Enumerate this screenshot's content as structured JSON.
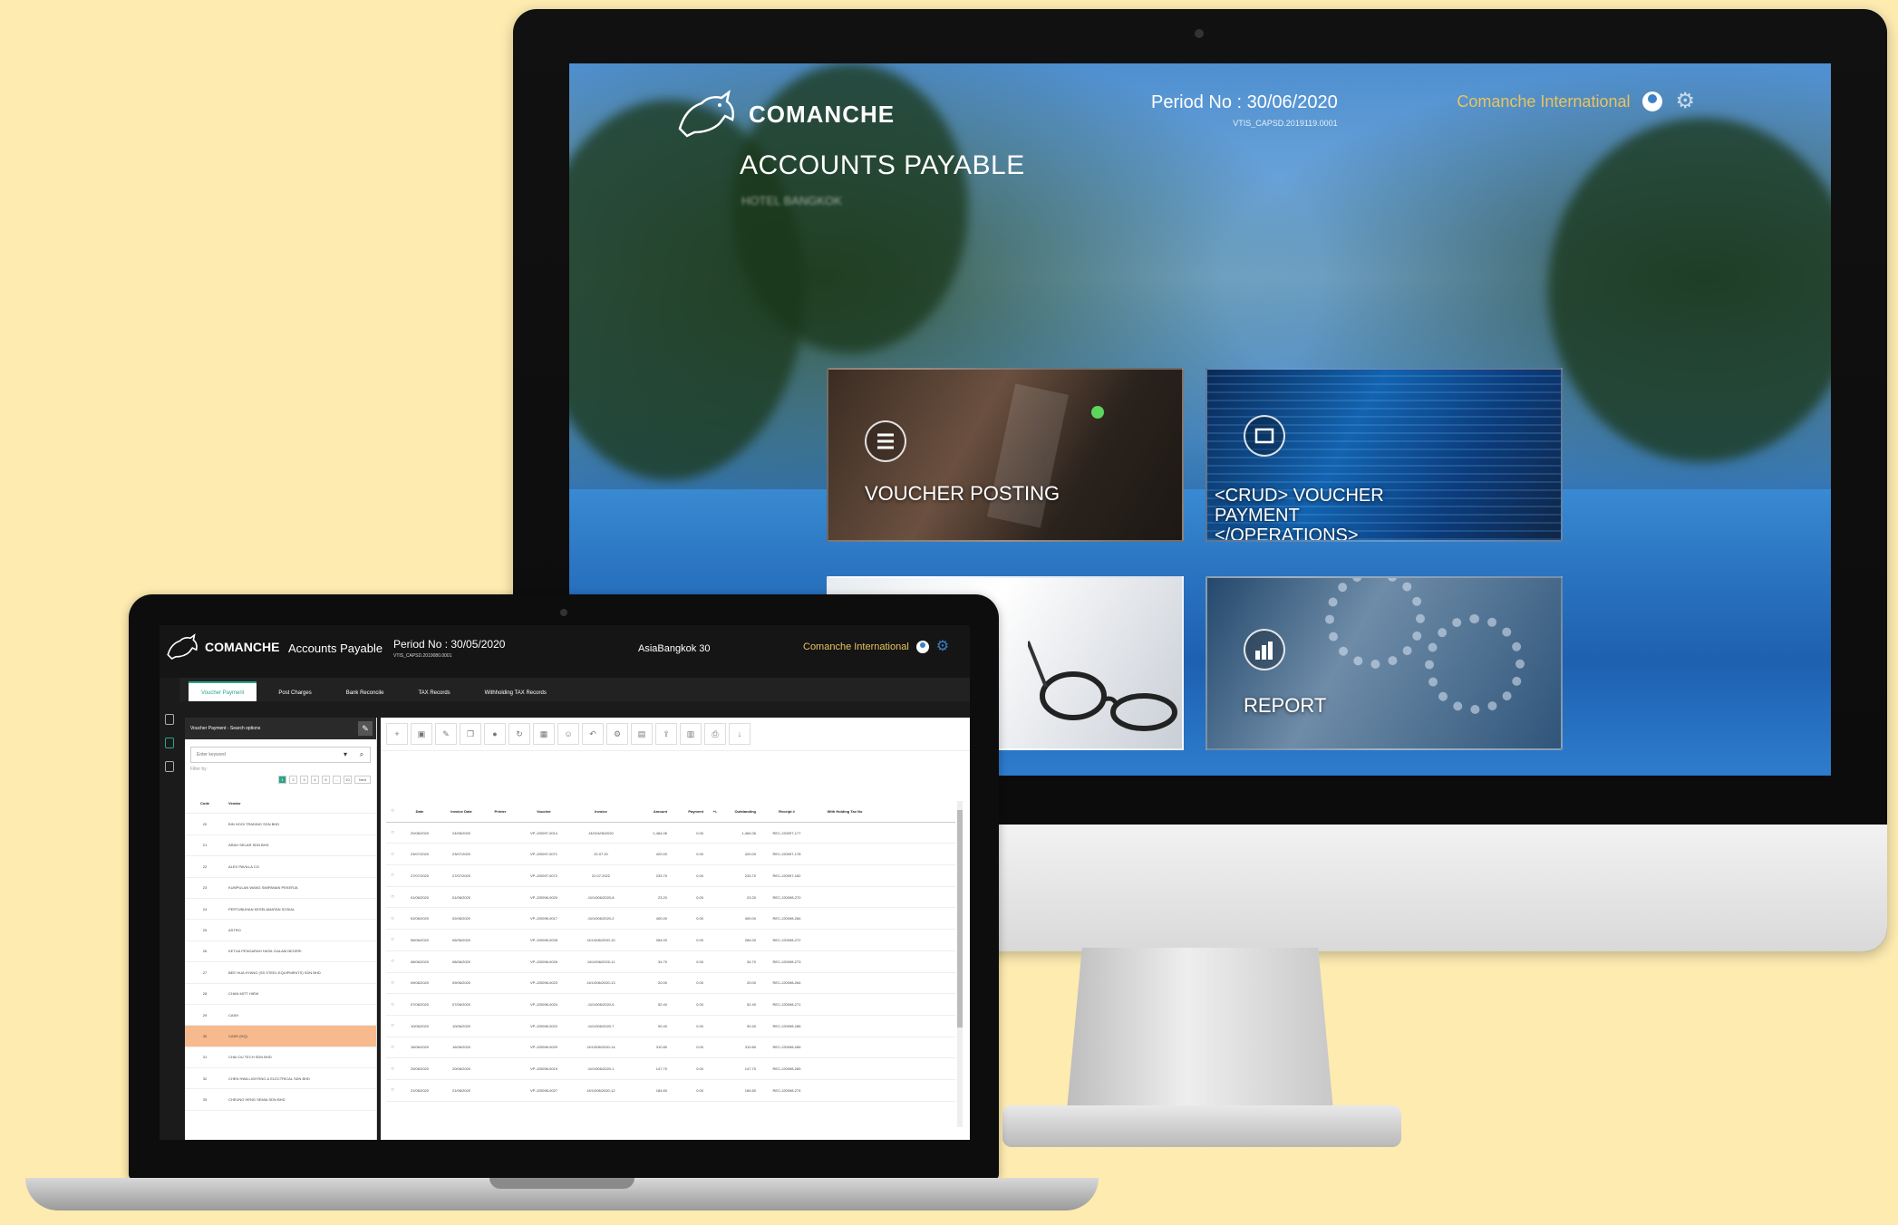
{
  "desktop": {
    "brand": "COMANCHE",
    "module_title": "ACCOUNTS PAYABLE",
    "module_subtitle": "HOTEL BANGKOK",
    "period": "Period No : 30/06/2020",
    "period_sub": "VTIS_CAPSD.2019119.0001",
    "user": "Comanche International",
    "tiles": [
      {
        "label": "VOUCHER POSTING",
        "icon": "list-icon"
      },
      {
        "label": "<CRUD> VOUCHER PAYMENT </OPERATIONS>",
        "icon": "payment-icon"
      },
      {
        "label": "",
        "icon": ""
      },
      {
        "label": "REPORT",
        "icon": "chart-icon"
      }
    ]
  },
  "laptop": {
    "brand": "COMANCHE",
    "module": "Accounts Payable",
    "period": "Period No : 30/05/2020",
    "period_sub": "VTIS_CAPSD.2019080.0001",
    "location": "AsiaBangkok 30",
    "user": "Comanche International",
    "tabs": [
      {
        "label": "Voucher Payment",
        "active": true
      },
      {
        "label": "Post Charges",
        "active": false
      },
      {
        "label": "Bank Reconcile",
        "active": false
      },
      {
        "label": "TAX Records",
        "active": false
      },
      {
        "label": "Withholding TAX Records",
        "active": false
      }
    ],
    "search_panel": {
      "title": "Voucher Payment - Search options",
      "placeholder": "Enter keyword",
      "filter": "Filter by",
      "pages": [
        "1",
        "2",
        "3",
        "4",
        "5",
        "...",
        "10",
        "Next"
      ],
      "columns": [
        "Code",
        "Vendor"
      ],
      "vendors": [
        {
          "code": "20",
          "name": "BIN HOOI TRADING SDN BHD",
          "selected": false
        },
        {
          "code": "21",
          "name": "ARAH SELAR SDN BHD",
          "selected": false
        },
        {
          "code": "22",
          "name": "ALEX PAVILLA CO",
          "selected": false
        },
        {
          "code": "23",
          "name": "KUMPULAN WANG SIMPANAN PEKERJA",
          "selected": false
        },
        {
          "code": "24",
          "name": "PERTUBUHAN KESELAMATAN SOSIAL",
          "selected": false
        },
        {
          "code": "25",
          "name": "ASTRO",
          "selected": false
        },
        {
          "code": "26",
          "name": "KETUA PENGARAH HASIL DALAM NEGERI",
          "selected": false
        },
        {
          "code": "27",
          "name": "BEE HUA HYANG (SS STEEL EQUIPMENTS) SDN BHD",
          "selected": false
        },
        {
          "code": "28",
          "name": "CHAN MITT HIEW",
          "selected": false
        },
        {
          "code": "29",
          "name": "CASH",
          "selected": false
        },
        {
          "code": "30",
          "name": "CASH (HQ)",
          "selected": true
        },
        {
          "code": "31",
          "name": "CHAI OU TECH SDN BHD",
          "selected": false
        },
        {
          "code": "32",
          "name": "CHEN HWA LIGHTING & ELECTRICAL SDN BHD",
          "selected": false
        },
        {
          "code": "33",
          "name": "CHEUNG HENG SEMIA SDN BHD",
          "selected": false
        }
      ]
    },
    "grid": {
      "columns": [
        "Date",
        "Invoice Date",
        "Printer",
        "Voucher",
        "Invoice",
        "Amount",
        "Payment",
        "+/-",
        "Outstanding",
        "Receipt #",
        "With Holding Tax No"
      ],
      "rows": [
        {
          "date": "20/06/2020",
          "invdate": "24/06/2020",
          "printer": "",
          "voucher": "VP-J20097-0014",
          "invoice": "J4/024/06/2020",
          "amount": "1,464.06",
          "payment": "0.00",
          "sep": "",
          "outstanding": "1,464.06",
          "receipt": "REC-J20097-177",
          "wht": ""
        },
        {
          "date": "23/07/2020",
          "invdate": "23/07/2020",
          "printer": "",
          "voucher": "VP-J20097-0071",
          "invoice": "22.07.20",
          "amount": "420.00",
          "payment": "0.00",
          "sep": "",
          "outstanding": "420.00",
          "receipt": "REC-J20097-178",
          "wht": ""
        },
        {
          "date": "27/07/2020",
          "invdate": "27/07/2020",
          "printer": "",
          "voucher": "VP-J20097-0072",
          "invoice": "22.07.2022",
          "amount": "233.70",
          "payment": "0.00",
          "sep": "",
          "outstanding": "233.70",
          "receipt": "REC-J20097-182",
          "wht": ""
        },
        {
          "date": "01/06/2020",
          "invdate": "01/06/2020",
          "printer": "",
          "voucher": "VP-J20098-0020",
          "invoice": "J4/1/006/2020-8",
          "amount": "23.20",
          "payment": "0.00",
          "sep": "",
          "outstanding": "23.20",
          "receipt": "REC-J20098-270",
          "wht": ""
        },
        {
          "date": "02/06/2020",
          "invdate": "02/06/2020",
          "printer": "",
          "voucher": "VP-J20098-0017",
          "invoice": "J4/1/006/2020-2",
          "amount": "400.00",
          "payment": "0.00",
          "sep": "",
          "outstanding": "400.00",
          "receipt": "REC-J20098-284",
          "wht": ""
        },
        {
          "date": "06/06/2020",
          "invdate": "06/06/2020",
          "printer": "",
          "voucher": "VP-J20098-0028",
          "invoice": "J4/1/006/2020-10",
          "amount": "284.00",
          "payment": "0.00",
          "sep": "",
          "outstanding": "284.00",
          "receipt": "REC-J20098-272",
          "wht": ""
        },
        {
          "date": "08/06/2020",
          "invdate": "08/06/2020",
          "printer": "",
          "voucher": "VP-J20098-0026",
          "invoice": "J4/1/006/2020-11",
          "amount": "34.70",
          "payment": "0.00",
          "sep": "",
          "outstanding": "34.70",
          "receipt": "REC-J20098-273",
          "wht": ""
        },
        {
          "date": "09/06/2020",
          "invdate": "09/06/2020",
          "printer": "",
          "voucher": "VP-J20098-0023",
          "invoice": "J4/1/006/2020-13",
          "amount": "20.00",
          "payment": "0.00",
          "sep": "",
          "outstanding": "20.00",
          "receipt": "REC-J20098-264",
          "wht": ""
        },
        {
          "date": "07/06/2020",
          "invdate": "07/06/2020",
          "printer": "",
          "voucher": "VP-J20098-0024",
          "invoice": "J4/1/006/2020-6",
          "amount": "52.40",
          "payment": "0.00",
          "sep": "",
          "outstanding": "52.40",
          "receipt": "REC-J20098-271",
          "wht": ""
        },
        {
          "date": "10/06/2020",
          "invdate": "10/06/2020",
          "printer": "",
          "voucher": "VP-J20098-0022",
          "invoice": "J4/1/006/2020-7",
          "amount": "90.40",
          "payment": "0.00",
          "sep": "",
          "outstanding": "90.40",
          "receipt": "REC-J20098-286",
          "wht": ""
        },
        {
          "date": "16/06/2020",
          "invdate": "16/06/2020",
          "printer": "",
          "voucher": "VP-J20098-0029",
          "invoice": "J4/1/006/2020-14",
          "amount": "310.80",
          "payment": "0.00",
          "sep": "",
          "outstanding": "310.80",
          "receipt": "REC-J20098-266",
          "wht": ""
        },
        {
          "date": "20/06/2020",
          "invdate": "20/06/2020",
          "printer": "",
          "voucher": "VP-J20098-0019",
          "invoice": "J4/1/006/2020-1",
          "amount": "147.70",
          "payment": "0.00",
          "sep": "",
          "outstanding": "147.70",
          "receipt": "REC-J20098-265",
          "wht": ""
        },
        {
          "date": "21/06/2020",
          "invdate": "21/06/2020",
          "printer": "",
          "voucher": "VP-J20098-0027",
          "invoice": "J4/1/006/2020-12",
          "amount": "184.60",
          "payment": "0.00",
          "sep": "",
          "outstanding": "184.60",
          "receipt": "REC-J20098-274",
          "wht": ""
        }
      ]
    }
  }
}
